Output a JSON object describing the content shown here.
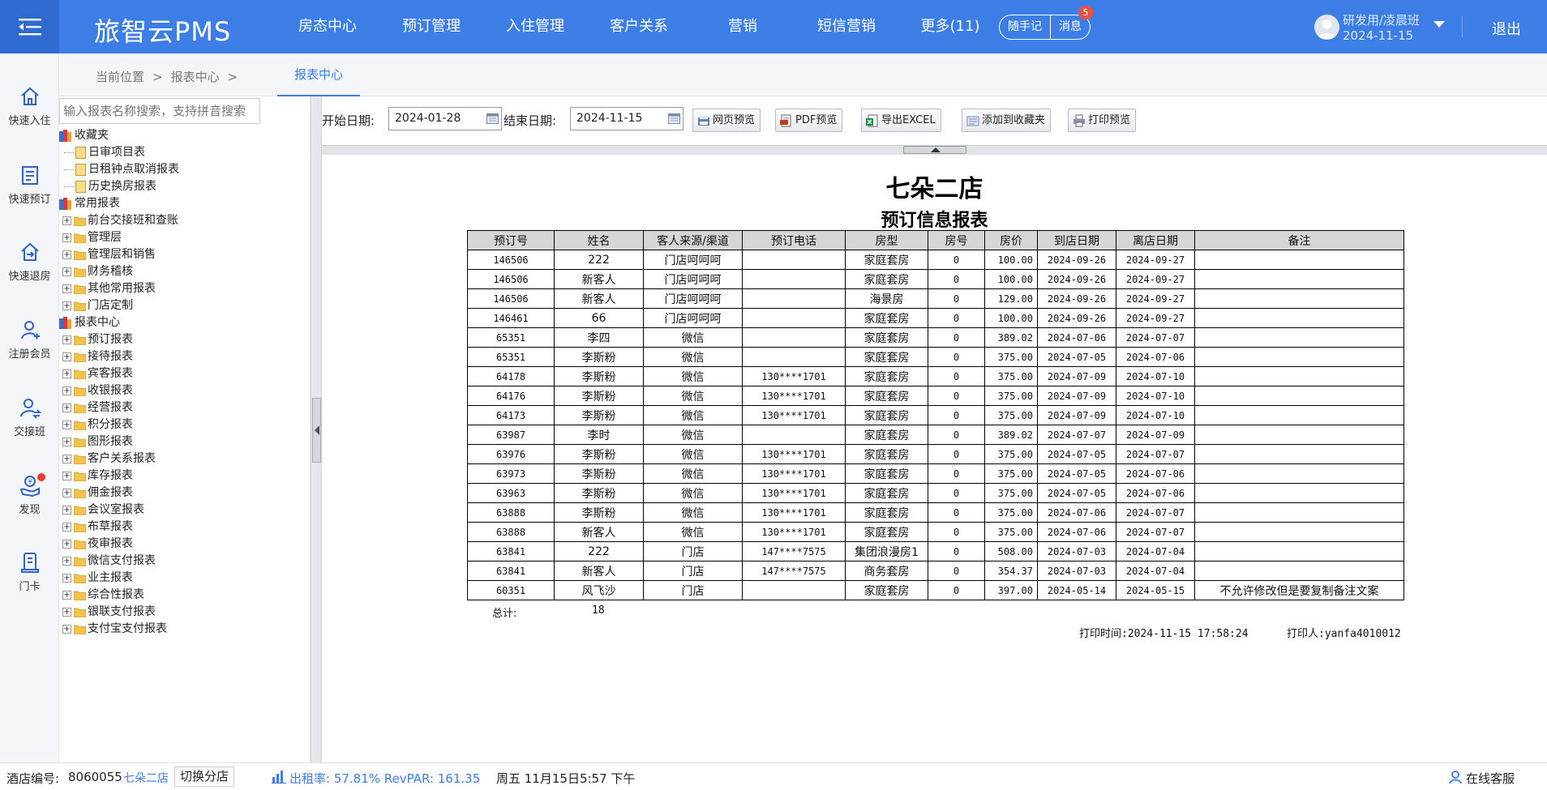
{
  "topbar": {
    "brand": "旅智云PMS",
    "nav": [
      "房态中心",
      "预订管理",
      "入住管理",
      "客户关系",
      "营销",
      "短信营销",
      "更多(11)"
    ],
    "notes_label": "随手记",
    "messages_label": "消息",
    "messages_count": "5",
    "user_name": "研发用/凌晨班",
    "user_date": "2024-11-15",
    "logout_label": "退出",
    "bar_color": "#3d7de6"
  },
  "rail": [
    {
      "label": "快速入住",
      "icon": "home-icon"
    },
    {
      "label": "快速预订",
      "icon": "booking-icon"
    },
    {
      "label": "快速退房",
      "icon": "checkout-icon"
    },
    {
      "label": "注册会员",
      "icon": "add-member-icon"
    },
    {
      "label": "交接班",
      "icon": "shift-handover-icon"
    },
    {
      "label": "发现",
      "icon": "discover-icon"
    },
    {
      "label": "门卡",
      "icon": "door-card-icon"
    }
  ],
  "breadcrumb": {
    "items": [
      "当前位置",
      ">",
      "报表中心",
      ">"
    ],
    "active_tab": "报表中心"
  },
  "tree": {
    "search_placeholder": "输入报表名称搜索，支持拼音搜索",
    "nodes": [
      {
        "label": "收藏夹",
        "type": "root"
      },
      {
        "label": "日审项目表",
        "type": "leaf"
      },
      {
        "label": "日租钟点取消报表",
        "type": "leaf"
      },
      {
        "label": "历史换房报表",
        "type": "leaf"
      },
      {
        "label": "常用报表",
        "type": "root"
      },
      {
        "label": "前台交接班和查账",
        "type": "folder"
      },
      {
        "label": "管理层",
        "type": "folder"
      },
      {
        "label": "管理层和销售",
        "type": "folder"
      },
      {
        "label": "财务稽核",
        "type": "folder"
      },
      {
        "label": "其他常用报表",
        "type": "folder"
      },
      {
        "label": "门店定制",
        "type": "folder"
      },
      {
        "label": "报表中心",
        "type": "root"
      },
      {
        "label": "预订报表",
        "type": "folder"
      },
      {
        "label": "接待报表",
        "type": "folder"
      },
      {
        "label": "宾客报表",
        "type": "folder"
      },
      {
        "label": "收银报表",
        "type": "folder"
      },
      {
        "label": "经营报表",
        "type": "folder"
      },
      {
        "label": "积分报表",
        "type": "folder"
      },
      {
        "label": "图形报表",
        "type": "folder"
      },
      {
        "label": "客户关系报表",
        "type": "folder"
      },
      {
        "label": "库存报表",
        "type": "folder"
      },
      {
        "label": "佣金报表",
        "type": "folder"
      },
      {
        "label": "会议室报表",
        "type": "folder"
      },
      {
        "label": "布草报表",
        "type": "folder"
      },
      {
        "label": "夜审报表",
        "type": "folder"
      },
      {
        "label": "微信支付报表",
        "type": "folder"
      },
      {
        "label": "业主报表",
        "type": "folder"
      },
      {
        "label": "综合性报表",
        "type": "folder"
      },
      {
        "label": "银联支付报表",
        "type": "folder"
      },
      {
        "label": "支付宝支付报表",
        "type": "folder"
      }
    ]
  },
  "toolbar": {
    "start_label": "开始日期:",
    "start_value": "2024-01-28",
    "end_label": "结束日期:",
    "end_value": "2024-11-15",
    "buttons": [
      "网页预览",
      "PDF预览",
      "导出EXCEL",
      "添加到收藏夹",
      "打印预览"
    ]
  },
  "report": {
    "title": "七朵二店",
    "subtitle": "预订信息报表",
    "columns": [
      "预订号",
      "姓名",
      "客人来源/渠道",
      "预订电话",
      "房型",
      "房号",
      "房价",
      "到店日期",
      "离店日期",
      "备注"
    ],
    "rows": [
      [
        "146506",
        "222",
        "门店呵呵呵",
        "",
        "家庭套房",
        "0",
        "100.00",
        "2024-09-26",
        "2024-09-27",
        ""
      ],
      [
        "146506",
        "新客人",
        "门店呵呵呵",
        "",
        "家庭套房",
        "0",
        "100.00",
        "2024-09-26",
        "2024-09-27",
        ""
      ],
      [
        "146506",
        "新客人",
        "门店呵呵呵",
        "",
        "海景房",
        "0",
        "129.00",
        "2024-09-26",
        "2024-09-27",
        ""
      ],
      [
        "146461",
        "66",
        "门店呵呵呵",
        "",
        "家庭套房",
        "0",
        "100.00",
        "2024-09-26",
        "2024-09-27",
        ""
      ],
      [
        "65351",
        "李四",
        "微信",
        "",
        "家庭套房",
        "0",
        "389.02",
        "2024-07-06",
        "2024-07-07",
        ""
      ],
      [
        "65351",
        "李斯粉",
        "微信",
        "",
        "家庭套房",
        "0",
        "375.00",
        "2024-07-05",
        "2024-07-06",
        ""
      ],
      [
        "64178",
        "李斯粉",
        "微信",
        "130****1701",
        "家庭套房",
        "0",
        "375.00",
        "2024-07-09",
        "2024-07-10",
        ""
      ],
      [
        "64176",
        "李斯粉",
        "微信",
        "130****1701",
        "家庭套房",
        "0",
        "375.00",
        "2024-07-09",
        "2024-07-10",
        ""
      ],
      [
        "64173",
        "李斯粉",
        "微信",
        "130****1701",
        "家庭套房",
        "0",
        "375.00",
        "2024-07-09",
        "2024-07-10",
        ""
      ],
      [
        "63987",
        "李时",
        "微信",
        "",
        "家庭套房",
        "0",
        "389.02",
        "2024-07-07",
        "2024-07-09",
        ""
      ],
      [
        "63976",
        "李斯粉",
        "微信",
        "130****1701",
        "家庭套房",
        "0",
        "375.00",
        "2024-07-05",
        "2024-07-07",
        ""
      ],
      [
        "63973",
        "李斯粉",
        "微信",
        "130****1701",
        "家庭套房",
        "0",
        "375.00",
        "2024-07-05",
        "2024-07-06",
        ""
      ],
      [
        "63963",
        "李斯粉",
        "微信",
        "130****1701",
        "家庭套房",
        "0",
        "375.00",
        "2024-07-05",
        "2024-07-06",
        ""
      ],
      [
        "63888",
        "李斯粉",
        "微信",
        "130****1701",
        "家庭套房",
        "0",
        "375.00",
        "2024-07-06",
        "2024-07-07",
        ""
      ],
      [
        "63888",
        "新客人",
        "微信",
        "130****1701",
        "家庭套房",
        "0",
        "375.00",
        "2024-07-06",
        "2024-07-07",
        ""
      ],
      [
        "63841",
        "222",
        "门店",
        "147****7575",
        "集团浪漫房1",
        "0",
        "508.00",
        "2024-07-03",
        "2024-07-04",
        ""
      ],
      [
        "63841",
        "新客人",
        "门店",
        "147****7575",
        "商务套房",
        "0",
        "354.37",
        "2024-07-03",
        "2024-07-04",
        ""
      ],
      [
        "60351",
        "风飞沙",
        "门店",
        "",
        "家庭套房",
        "0",
        "397.00",
        "2024-05-14",
        "2024-05-15",
        "不允许修改但是要复制备注文案"
      ]
    ],
    "total_label": "总计:",
    "total_value": "18",
    "print_time": "打印时间:2024-11-15 17:58:24",
    "print_user": "打印人:yanfa4010012"
  },
  "statusbar": {
    "store_no_label": "酒店编号:",
    "store_no": "8060055",
    "store_name": "七朵二店",
    "switch_label": "切换分店",
    "occupancy": "出租率: 57.81% RevPAR: 161.35",
    "datetime": "周五 11月15日5:57 下午",
    "support_label": "在线客服"
  }
}
